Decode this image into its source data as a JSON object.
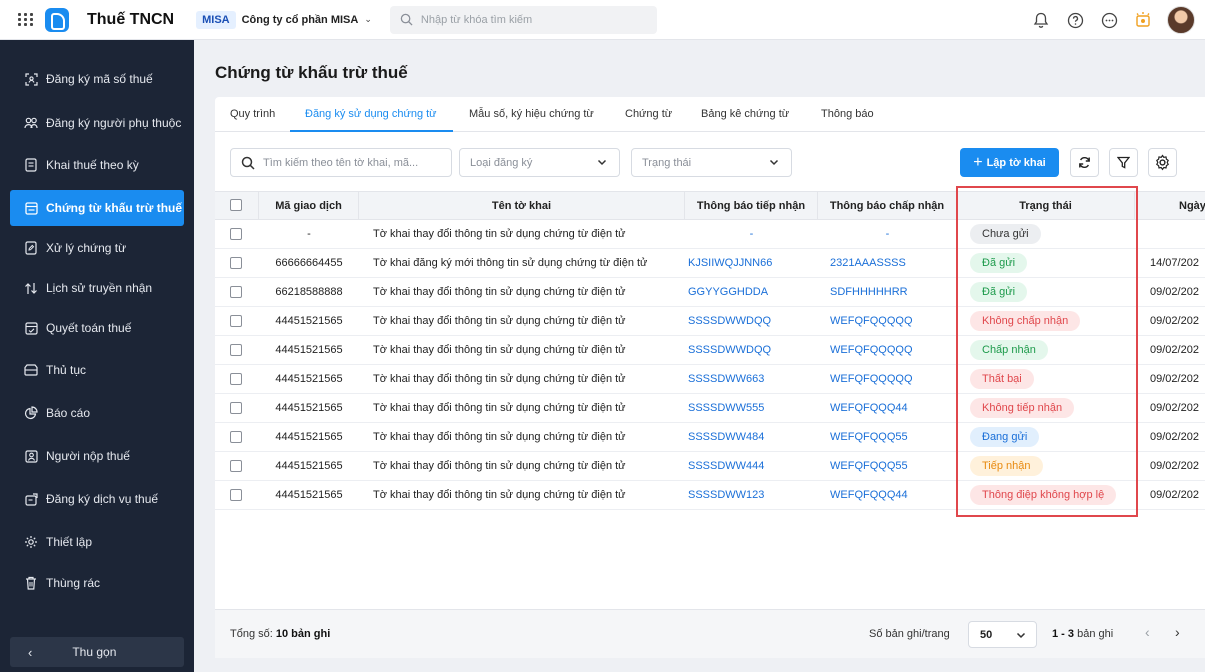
{
  "app": {
    "title": "Thuế TNCN",
    "company_tag": "MISA",
    "company_name": "Công ty cổ phần MISA",
    "search_placeholder": "Nhập từ khóa tìm kiếm"
  },
  "sidebar": {
    "items": [
      {
        "label": "Đăng ký mã số thuế",
        "icon": "id-card-icon"
      },
      {
        "label": "Đăng ký người phụ thuộc",
        "icon": "people-icon"
      },
      {
        "label": "Khai thuế theo kỳ",
        "icon": "document-icon"
      },
      {
        "label": "Chứng từ khấu trừ thuế",
        "icon": "certificate-icon"
      },
      {
        "label": "Xử lý chứng từ",
        "icon": "edit-document-icon"
      },
      {
        "label": "Lịch sử truyền nhận",
        "icon": "transfer-arrows-icon"
      },
      {
        "label": "Quyết toán thuế",
        "icon": "settlement-icon"
      },
      {
        "label": "Thủ tục",
        "icon": "folder-icon"
      },
      {
        "label": "Báo cáo",
        "icon": "pie-chart-icon"
      },
      {
        "label": "Người nộp thuế",
        "icon": "person-card-icon"
      },
      {
        "label": "Đăng ký dịch vụ thuế",
        "icon": "service-icon"
      },
      {
        "label": "Thiết lập",
        "icon": "gear-icon"
      },
      {
        "label": "Thùng rác",
        "icon": "trash-icon"
      }
    ],
    "active_index": 3,
    "collapse_label": "Thu gọn"
  },
  "page": {
    "title": "Chứng từ khấu trừ thuế"
  },
  "tabs": [
    "Quy trình",
    "Đăng ký sử dụng chứng từ",
    "Mẫu số, ký hiệu chứng từ",
    "Chứng từ",
    "Bảng kê chứng từ",
    "Thông báo"
  ],
  "filters": {
    "search_placeholder": "Tìm kiếm theo tên tờ khai, mã...",
    "type_placeholder": "Loại đăng ký",
    "status_placeholder": "Trạng thái",
    "create_label": "Lập tờ khai"
  },
  "table": {
    "headers": [
      "Mã giao dịch",
      "Tên tờ khai",
      "Thông báo tiếp nhận",
      "Thông báo chấp nhận",
      "Trạng thái",
      "Ngày"
    ],
    "rows": [
      {
        "code": "-",
        "name": "Tờ khai thay đổi thông tin sử dụng chứng từ điện tử",
        "receipt": "-",
        "accept": "-",
        "status": "Chưa gửi",
        "status_color": "grey",
        "date": "-"
      },
      {
        "code": "66666664455",
        "name": "Tờ khai đăng ký mới thông tin sử dụng chứng từ điện tử",
        "receipt": "KJSIIWQJJNN66",
        "accept": "2321AAASSSS",
        "status": "Đã gửi",
        "status_color": "green",
        "date": "14/07/202"
      },
      {
        "code": "66218588888",
        "name": "Tờ khai thay đổi thông tin sử dụng chứng từ điện tử",
        "receipt": "GGYYGGHDDA",
        "accept": "SDFHHHHHRR",
        "status": "Đã gửi",
        "status_color": "green",
        "date": "09/02/202"
      },
      {
        "code": "44451521565",
        "name": "Tờ khai thay đổi thông tin sử dụng chứng từ điện tử",
        "receipt": "SSSSDWWDQQ",
        "accept": "WEFQFQQQQQ",
        "status": "Không chấp nhận",
        "status_color": "red",
        "date": "09/02/202"
      },
      {
        "code": "44451521565",
        "name": "Tờ khai thay đổi thông tin sử dụng chứng từ điện tử",
        "receipt": "SSSSDWWDQQ",
        "accept": "WEFQFQQQQQ",
        "status": "Chấp nhận",
        "status_color": "green",
        "date": "09/02/202"
      },
      {
        "code": "44451521565",
        "name": "Tờ khai thay đổi thông tin sử dụng chứng từ điện tử",
        "receipt": "SSSSDWW663",
        "accept": "WEFQFQQQQQ",
        "status": "Thất bại",
        "status_color": "red",
        "date": "09/02/202"
      },
      {
        "code": "44451521565",
        "name": "Tờ khai thay đổi thông tin sử dụng chứng từ điện tử",
        "receipt": "SSSSDWW555",
        "accept": "WEFQFQQQ44",
        "status": "Không tiếp nhận",
        "status_color": "red",
        "date": "09/02/202"
      },
      {
        "code": "44451521565",
        "name": "Tờ khai thay đổi thông tin sử dụng chứng từ điện tử",
        "receipt": "SSSSDWW484",
        "accept": "WEFQFQQQ55",
        "status": "Đang gửi",
        "status_color": "blue",
        "date": "09/02/202"
      },
      {
        "code": "44451521565",
        "name": "Tờ khai thay đổi thông tin sử dụng chứng từ điện tử",
        "receipt": "SSSSDWW444",
        "accept": "WEFQFQQQ55",
        "status": "Tiếp nhận",
        "status_color": "orange",
        "date": "09/02/202"
      },
      {
        "code": "44451521565",
        "name": "Tờ khai thay đổi thông tin sử dụng chứng từ điện tử",
        "receipt": "SSSSDWW123",
        "accept": "WEFQFQQQ44",
        "status": "Thông điệp không hợp lệ",
        "status_color": "red",
        "date": "09/02/202"
      }
    ]
  },
  "footer": {
    "total_label": "Tổng số:",
    "total_value": "10 bản ghi",
    "per_page_label": "Số bản ghi/trang",
    "per_page_value": "50",
    "range_value": "1 - 3",
    "range_suffix": "bản ghi"
  },
  "colors": {
    "accent": "#1a8cf0",
    "sidebar_bg": "#1c2536",
    "highlight": "#e0474c"
  }
}
